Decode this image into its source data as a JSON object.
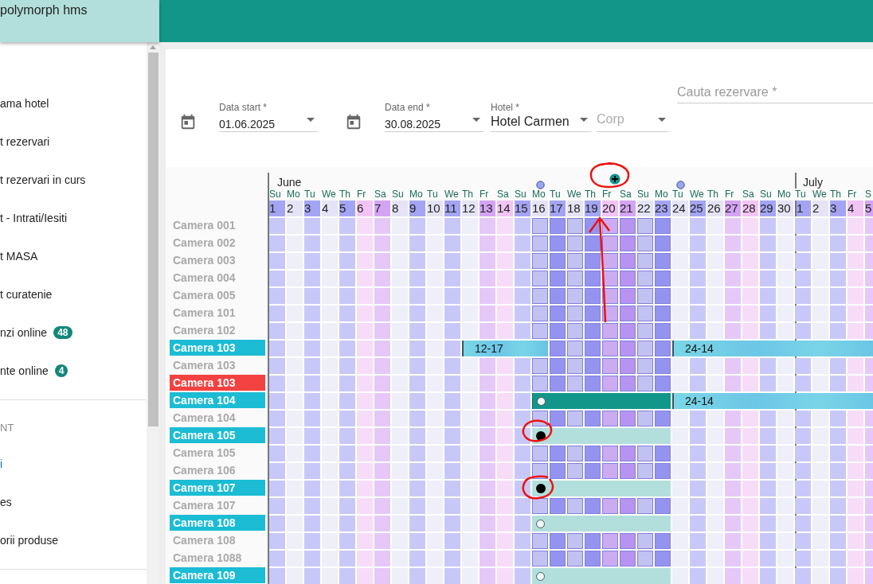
{
  "app": {
    "title": "polymorph hms"
  },
  "sidebar": {
    "groups": [
      {
        "items": [
          {
            "label": "ama hotel",
            "selected": false
          },
          {
            "label": "t rezervari",
            "selected": false
          },
          {
            "label": "t rezervari in curs",
            "selected": false
          },
          {
            "label": "t - Intrati/Iesiti",
            "selected": false
          },
          {
            "label": "t MASA",
            "selected": false
          },
          {
            "label": "t curatenie",
            "selected": false
          },
          {
            "label": "nzi online",
            "badge": "48",
            "selected": false
          },
          {
            "label": "nte online",
            "badge": "4",
            "selected": false
          }
        ]
      },
      {
        "heading": "NT",
        "items": [
          {
            "label": "i",
            "selected": true
          },
          {
            "label": "es",
            "selected": false
          },
          {
            "label": "orii produse",
            "selected": false
          }
        ]
      }
    ]
  },
  "filters": {
    "date_start": {
      "label": "Data start *",
      "value": "01.06.2025"
    },
    "date_end": {
      "label": "Data end *",
      "value": "30.08.2025"
    },
    "hotel": {
      "label": "Hotel *",
      "value": "Hotel Carmen"
    },
    "corp": {
      "placeholder": "Corp"
    },
    "search": {
      "placeholder": "Cauta rezervare *"
    }
  },
  "calendar": {
    "months": [
      {
        "name": "June"
      },
      {
        "name": "July"
      }
    ],
    "days": [
      {
        "weekday": "Su",
        "day": "1",
        "color": "#a4a4f4",
        "selected": false,
        "kind": "plain"
      },
      {
        "weekday": "Mo",
        "day": "2",
        "color": "#e4e4f6",
        "selected": false,
        "kind": "plain"
      },
      {
        "weekday": "Tu",
        "day": "3",
        "color": "#a4a4f4",
        "selected": false,
        "kind": "plain"
      },
      {
        "weekday": "We",
        "day": "4",
        "color": "#e4e4f6",
        "selected": false,
        "kind": "plain"
      },
      {
        "weekday": "Th",
        "day": "5",
        "color": "#a4a4f4",
        "selected": false,
        "kind": "plain"
      },
      {
        "weekday": "Fr",
        "day": "6",
        "color": "#f2c4f4",
        "selected": false,
        "kind": "plain"
      },
      {
        "weekday": "Sa",
        "day": "7",
        "color": "#d4a4f4",
        "selected": false,
        "kind": "plain"
      },
      {
        "weekday": "Su",
        "day": "8",
        "color": "#e4e4f6",
        "selected": false,
        "kind": "plain"
      },
      {
        "weekday": "Mo",
        "day": "9",
        "color": "#a4a4f4",
        "selected": false,
        "kind": "plain"
      },
      {
        "weekday": "Tu",
        "day": "10",
        "color": "#e4e4f6",
        "selected": false,
        "kind": "plain"
      },
      {
        "weekday": "We",
        "day": "11",
        "color": "#a4a4f4",
        "selected": false,
        "kind": "plain"
      },
      {
        "weekday": "Th",
        "day": "12",
        "color": "#e4e4f6",
        "selected": false,
        "kind": "plain"
      },
      {
        "weekday": "Fr",
        "day": "13",
        "color": "#d4a4f4",
        "selected": false,
        "kind": "plain"
      },
      {
        "weekday": "Sa",
        "day": "14",
        "color": "#f2c4f4",
        "selected": false,
        "kind": "plain"
      },
      {
        "weekday": "Su",
        "day": "15",
        "color": "#a4a4f4",
        "selected": false,
        "kind": "plain"
      },
      {
        "weekday": "Mo",
        "day": "16",
        "color": "#e4e4f6",
        "selected": true,
        "kind": "dot"
      },
      {
        "weekday": "Tu",
        "day": "17",
        "color": "#a4a4f4",
        "selected": true,
        "kind": "plain"
      },
      {
        "weekday": "We",
        "day": "18",
        "color": "#e4e4f6",
        "selected": true,
        "kind": "plain"
      },
      {
        "weekday": "Th",
        "day": "19",
        "color": "#a4a4f4",
        "selected": true,
        "kind": "plain"
      },
      {
        "weekday": "Fr",
        "day": "20",
        "color": "#f2c4f4",
        "selected": true,
        "kind": "plus"
      },
      {
        "weekday": "Sa",
        "day": "21",
        "color": "#d4a4f4",
        "selected": true,
        "kind": "plain"
      },
      {
        "weekday": "Su",
        "day": "22",
        "color": "#e4e4f6",
        "selected": true,
        "kind": "plain"
      },
      {
        "weekday": "Mo",
        "day": "23",
        "color": "#a4a4f4",
        "selected": true,
        "kind": "plain"
      },
      {
        "weekday": "Tu",
        "day": "24",
        "color": "#e4e4f6",
        "selected": false,
        "kind": "dot"
      },
      {
        "weekday": "We",
        "day": "25",
        "color": "#a4a4f4",
        "selected": false,
        "kind": "plain"
      },
      {
        "weekday": "Th",
        "day": "26",
        "color": "#e4e4f6",
        "selected": false,
        "kind": "plain"
      },
      {
        "weekday": "Fr",
        "day": "27",
        "color": "#d4a4f4",
        "selected": false,
        "kind": "plain"
      },
      {
        "weekday": "Sa",
        "day": "28",
        "color": "#f2c4f4",
        "selected": false,
        "kind": "plain"
      },
      {
        "weekday": "Su",
        "day": "29",
        "color": "#a4a4f4",
        "selected": false,
        "kind": "plain"
      },
      {
        "weekday": "Mo",
        "day": "30",
        "color": "#e4e4f6",
        "selected": false,
        "kind": "plain"
      },
      {
        "weekday": "Tu",
        "day": "1",
        "color": "#a4a4f4",
        "selected": false,
        "kind": "plain"
      },
      {
        "weekday": "We",
        "day": "2",
        "color": "#e4e4f6",
        "selected": false,
        "kind": "plain"
      },
      {
        "weekday": "Th",
        "day": "3",
        "color": "#a4a4f4",
        "selected": false,
        "kind": "plain"
      },
      {
        "weekday": "Fr",
        "day": "4",
        "color": "#f2c4f4",
        "selected": false,
        "kind": "plain"
      },
      {
        "weekday": "S",
        "day": "5",
        "color": "#d4a4f4",
        "selected": false,
        "kind": "plain"
      }
    ],
    "rooms": [
      {
        "name": "Camera 001"
      },
      {
        "name": "Camera 002"
      },
      {
        "name": "Camera 003"
      },
      {
        "name": "Camera 004"
      },
      {
        "name": "Camera 005"
      },
      {
        "name": "Camera 101"
      },
      {
        "name": "Camera 102"
      },
      {
        "name": "Camera 103",
        "color": "#1bbcd4"
      },
      {
        "name": "Camera 103"
      },
      {
        "name": "Camera 103",
        "color": "#f44141"
      },
      {
        "name": "Camera 104",
        "color": "#1bbcd4"
      },
      {
        "name": "Camera 104"
      },
      {
        "name": "Camera 105",
        "color": "#1bbcd4"
      },
      {
        "name": "Camera 105"
      },
      {
        "name": "Camera 106"
      },
      {
        "name": "Camera 107",
        "color": "#1bbcd4"
      },
      {
        "name": "Camera 107"
      },
      {
        "name": "Camera 108",
        "color": "#1bbcd4"
      },
      {
        "name": "Camera 108"
      },
      {
        "name": "Camera 1088"
      },
      {
        "name": "Camera 109",
        "color": "#1bbcd4"
      }
    ],
    "bookings": [
      {
        "kind": "cyan",
        "label": "12-17"
      },
      {
        "kind": "cyan",
        "label": "24-14"
      },
      {
        "kind": "teal_hollow"
      },
      {
        "kind": "cyan",
        "label": "24-14"
      },
      {
        "kind": "mint_filled"
      },
      {
        "kind": "mint_filled"
      },
      {
        "kind": "mint_hollow"
      },
      {
        "kind": "mint_hollow"
      }
    ]
  }
}
